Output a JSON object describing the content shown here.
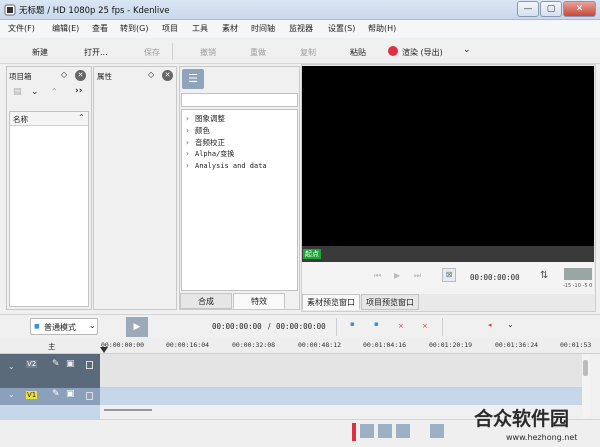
{
  "window": {
    "title": "无标题 / HD 1080p 25 fps - Kdenlive",
    "min_label": "—",
    "max_label": "▢",
    "close_label": "✕"
  },
  "menu": [
    "文件(F)",
    "编辑(E)",
    "查看",
    "转到(G)",
    "项目",
    "工具",
    "素材",
    "时间轴",
    "监视器",
    "设置(S)",
    "帮助(H)"
  ],
  "toolbar": {
    "new": "新建",
    "open": "打开...",
    "save": "保存",
    "undo": "撤销",
    "redo": "重做",
    "copy": "复制",
    "paste": "粘贴",
    "render": "渲染 (导出)"
  },
  "bin": {
    "title": "项目箱",
    "column_name": "名称"
  },
  "properties": {
    "title": "属性"
  },
  "effects": {
    "items": [
      "图象调整",
      "颜色",
      "音频校正",
      "Alpha/变换",
      "Analysis and data"
    ],
    "tabs": [
      "合成",
      "特效"
    ]
  },
  "monitor": {
    "mark_in": "起点",
    "timecode": "00:00:00:00",
    "audio_scale": "-15 -10 -5 0",
    "tabs": [
      "素材预览窗口",
      "项目预览窗口"
    ]
  },
  "timeline": {
    "mode": "普通模式",
    "position": "00:00:00:00",
    "separator": "/",
    "duration": "00:00:00:00",
    "master_label": "主",
    "ticks": [
      "00:00:00:00",
      "00:00:16:04",
      "00:00:32:08",
      "00:00:48:12",
      "00:01:04:16",
      "00:01:20:19",
      "00:01:36:24",
      "00:01:53"
    ],
    "tracks": [
      {
        "name": "V2"
      },
      {
        "name": "V1"
      }
    ]
  },
  "watermark": {
    "name": "合众软件园",
    "url": "www.hezhong.net"
  },
  "colors": {
    "accent": "#3a8ee6",
    "render_red": "#e03040",
    "mark_green": "#1aa535",
    "track_head": "#5b6a7a"
  }
}
